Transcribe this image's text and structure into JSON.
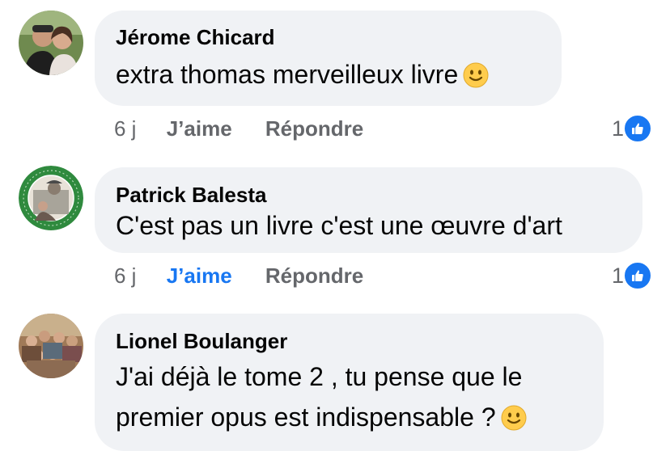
{
  "comments": [
    {
      "author": "Jérome Chicard",
      "lines": [
        "extra thomas merveilleux livre"
      ],
      "time": "6 j",
      "like_label": "J’aime",
      "reply_label": "Répondre",
      "like_count": "1",
      "liked_by_viewer": false,
      "emoji": "slightly-smiling-face"
    },
    {
      "author": "Patrick Balesta",
      "lines": [
        "C'est pas un livre c'est une œuvre d'art"
      ],
      "time": "6 j",
      "like_label": "J’aime",
      "reply_label": "Répondre",
      "like_count": "1",
      "liked_by_viewer": true
    },
    {
      "author": "Lionel Boulanger",
      "lines": [
        "J'ai déjà le tome 2 , tu pense que le",
        "premier opus est indispensable ?"
      ],
      "emoji": "slightly-smiling-face"
    }
  ],
  "colors": {
    "bubble": "#f0f2f5",
    "like_active": "#1877f2",
    "meta_text": "#65676b",
    "reaction_badge": "#1877f2"
  }
}
